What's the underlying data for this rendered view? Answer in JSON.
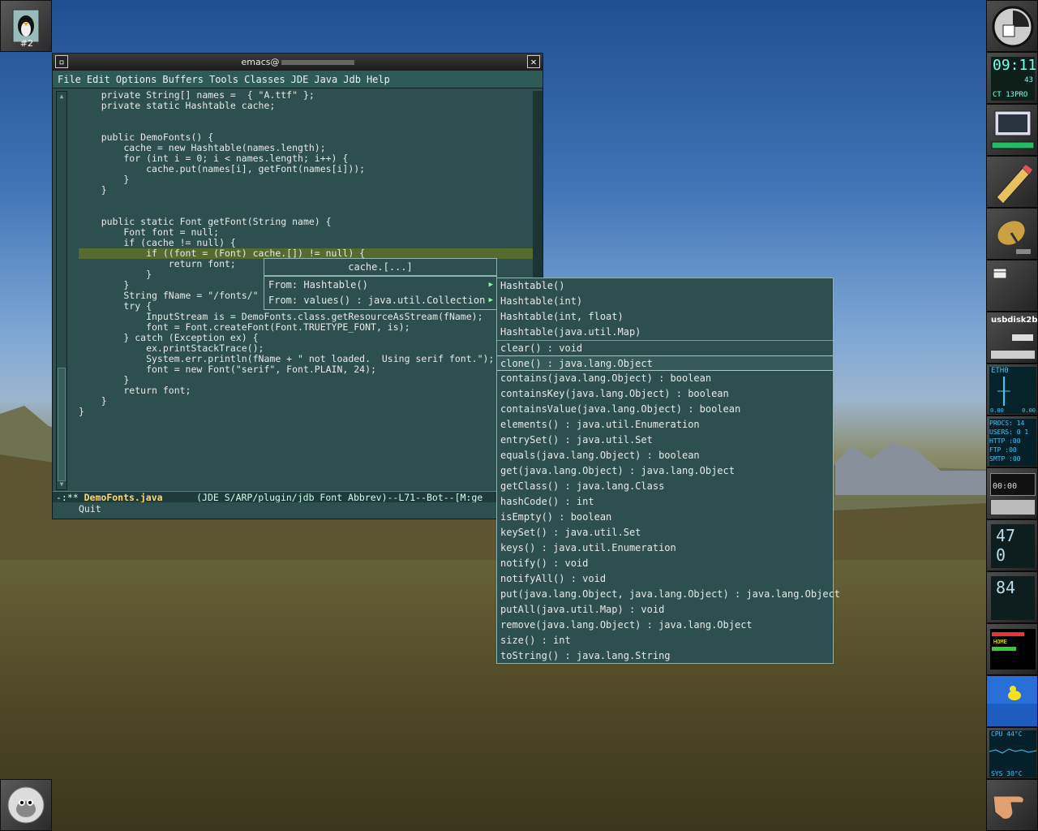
{
  "desktop": {
    "workspace_badge": "#2"
  },
  "emacs": {
    "title": "emacs@",
    "menu": [
      "File",
      "Edit",
      "Options",
      "Buffers",
      "Tools",
      "Classes",
      "JDE",
      "Java",
      "Jdb",
      "Help"
    ],
    "code_lines": [
      "    private String[] names =  { \"A.ttf\" };",
      "    private static Hashtable cache;",
      "",
      "",
      "    public DemoFonts() {",
      "        cache = new Hashtable(names.length);",
      "        for (int i = 0; i < names.length; i++) {",
      "            cache.put(names[i], getFont(names[i]));",
      "        }",
      "    }",
      "",
      "",
      "    public static Font getFont(String name) {",
      "        Font font = null;",
      "        if (cache != null) {",
      "            if ((font = (Font) cache.[]) != null) {",
      "                return font;",
      "            }",
      "        }",
      "        String fName = \"/fonts/\"",
      "        try {",
      "            InputStream is = DemoFonts.class.getResourceAsStream(fName);",
      "            font = Font.createFont(Font.TRUETYPE_FONT, is);",
      "        } catch (Exception ex) {",
      "            ex.printStackTrace();",
      "            System.err.println(fName + \" not loaded.  Using serif font.\");",
      "            font = new Font(\"serif\", Font.PLAIN, 24);",
      "        }",
      "        return font;",
      "    }",
      "}"
    ],
    "modeline": {
      "prefix": "-:** ",
      "buffer": "DemoFonts.java",
      "rest": "      (JDE S/ARP/plugin/jdb Font Abbrev)--L71--Bot--[M:ge"
    },
    "minibuffer": "Quit"
  },
  "completion": {
    "title": "cache.[...]",
    "from_items": [
      "From: Hashtable()",
      "From: values() : java.util.Collection"
    ],
    "methods": [
      "Hashtable()",
      "Hashtable(int)",
      "Hashtable(int, float)",
      "Hashtable(java.util.Map)",
      "clear() : void",
      "clone() : java.lang.Object",
      "contains(java.lang.Object) : boolean",
      "containsKey(java.lang.Object) : boolean",
      "containsValue(java.lang.Object) : boolean",
      "elements() : java.util.Enumeration",
      "entrySet() : java.util.Set",
      "equals(java.lang.Object) : boolean",
      "get(java.lang.Object) : java.lang.Object",
      "getClass() : java.lang.Class",
      "hashCode() : int",
      "isEmpty() : boolean",
      "keySet() : java.util.Set",
      "keys() : java.util.Enumeration",
      "notify() : void",
      "notifyAll() : void",
      "put(java.lang.Object, java.lang.Object) : java.lang.Object",
      "putAll(java.util.Map) : void",
      "remove(java.lang.Object) : java.lang.Object",
      "size() : int",
      "toString() : java.lang.String"
    ]
  },
  "dock": {
    "clock_time": "09:11",
    "clock_seconds": "43",
    "clock_sub": "CT 13PRO",
    "usb_label": "usbdisk2b",
    "net_label": "ETH0",
    "net_values": [
      "0.00",
      "0.00"
    ],
    "procs": [
      "PROCS: 14",
      "USERS: 0 1",
      "HTTP  :00",
      "FTP   :00",
      "SMTP  :00"
    ],
    "player_time": "00:00",
    "cpu_pct_1": "47",
    "cpu_pct_2": "0",
    "mem_pct": "84",
    "temp_cpu": "CPU  44°C",
    "temp_sys": "SYS  30°C",
    "home_label": "HOME"
  }
}
